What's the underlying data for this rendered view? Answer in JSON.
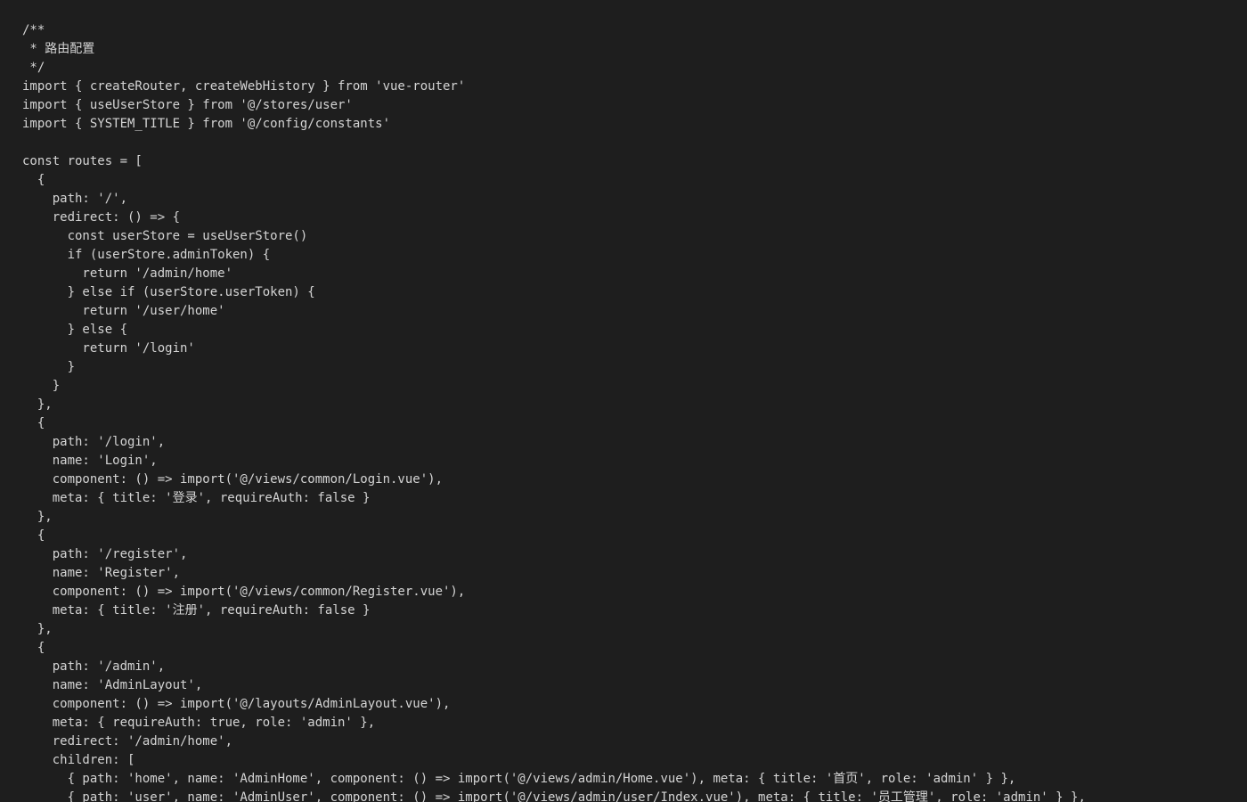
{
  "editor": {
    "background": "#1e1e1e",
    "text_color": "#d4d4d4",
    "lines": [
      "/**",
      " * 路由配置",
      " */",
      "import { createRouter, createWebHistory } from 'vue-router'",
      "import { useUserStore } from '@/stores/user'",
      "import { SYSTEM_TITLE } from '@/config/constants'",
      "",
      "const routes = [",
      "  {",
      "    path: '/',",
      "    redirect: () => {",
      "      const userStore = useUserStore()",
      "      if (userStore.adminToken) {",
      "        return '/admin/home'",
      "      } else if (userStore.userToken) {",
      "        return '/user/home'",
      "      } else {",
      "        return '/login'",
      "      }",
      "    }",
      "  },",
      "  {",
      "    path: '/login',",
      "    name: 'Login',",
      "    component: () => import('@/views/common/Login.vue'),",
      "    meta: { title: '登录', requireAuth: false }",
      "  },",
      "  {",
      "    path: '/register',",
      "    name: 'Register',",
      "    component: () => import('@/views/common/Register.vue'),",
      "    meta: { title: '注册', requireAuth: false }",
      "  },",
      "  {",
      "    path: '/admin',",
      "    name: 'AdminLayout',",
      "    component: () => import('@/layouts/AdminLayout.vue'),",
      "    meta: { requireAuth: true, role: 'admin' },",
      "    redirect: '/admin/home',",
      "    children: [",
      "      { path: 'home', name: 'AdminHome', component: () => import('@/views/admin/Home.vue'), meta: { title: '首页', role: 'admin' } },",
      "      { path: 'user', name: 'AdminUser', component: () => import('@/views/admin/user/Index.vue'), meta: { title: '员工管理', role: 'admin' } },"
    ]
  }
}
